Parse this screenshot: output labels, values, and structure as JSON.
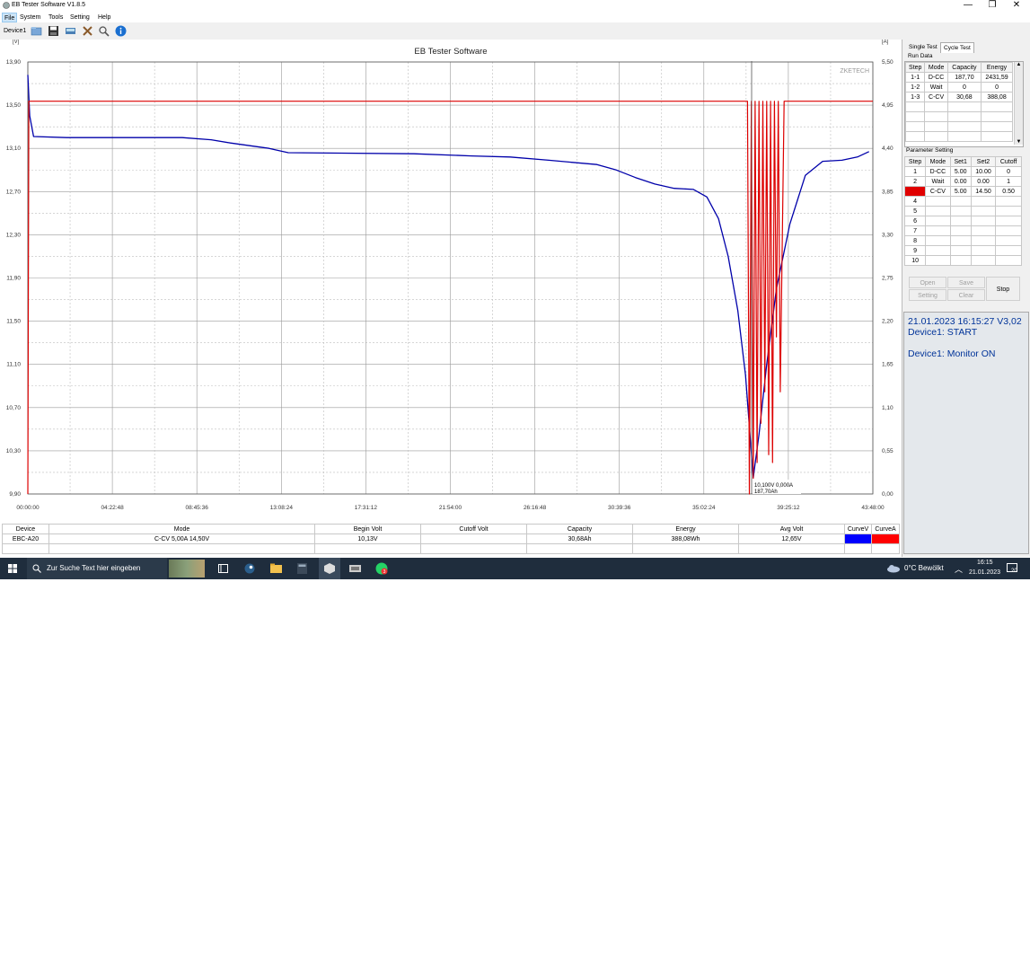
{
  "window": {
    "title": "EB Tester Software V1.8.5",
    "controls": [
      "—",
      "❐",
      "✕"
    ]
  },
  "menu": [
    "File",
    "System",
    "Tools",
    "Setting",
    "Help"
  ],
  "toolbar": {
    "device_label": "Device1",
    "icons": [
      "open-folder-icon",
      "save-icon",
      "monitor-icon",
      "tools-icon",
      "zoom-icon",
      "info-icon"
    ]
  },
  "chart": {
    "title": "EB Tester Software",
    "watermark": "ZKETECH",
    "left_axis_ticks": [
      "13,90",
      "13,50",
      "13,10",
      "12,70",
      "12,30",
      "11,90",
      "11,50",
      "11,10",
      "10,70",
      "10,30",
      "9,90"
    ],
    "right_axis_ticks": [
      "5,50",
      "4,95",
      "4,40",
      "3,85",
      "3,30",
      "2,75",
      "2,20",
      "1,65",
      "1,10",
      "0,55",
      "0,00"
    ],
    "x_axis_ticks": [
      "00:00:00",
      "04:22:48",
      "08:45:36",
      "13:08:24",
      "17:31:12",
      "21:54:00",
      "26:16:48",
      "30:39:36",
      "35:02:24",
      "39:25:12",
      "43:48:00"
    ],
    "left_unit": "[V]",
    "right_unit": "[A]",
    "cursor_label_line1": "10,100V  0,000A",
    "cursor_label_line2": "187,70Ah"
  },
  "chart_data": {
    "type": "line",
    "title": "EB Tester Software",
    "xlabel": "",
    "ylabel": "[V]",
    "y2label": "[A]",
    "ylim": [
      9.9,
      13.9
    ],
    "y2lim": [
      0,
      5.5
    ],
    "x_unit": "hours",
    "xlim": [
      0,
      43.8
    ],
    "grid": true,
    "series": [
      {
        "axis": "left",
        "color": "#0000aa",
        "x": [
          0,
          0.1,
          0.3,
          2,
          8,
          9.5,
          10.5,
          12.5,
          13.5,
          20,
          23,
          25,
          27,
          29.5,
          30.5,
          31.5,
          32.5,
          33.5,
          34.5,
          35.2,
          35.8,
          36.3,
          36.8,
          37.2,
          37.45,
          37.6,
          37.9,
          38.3,
          38.8,
          39.5,
          40.3,
          41.2,
          42.2,
          43.0,
          43.6
        ],
        "y": [
          13.78,
          13.4,
          13.21,
          13.2,
          13.2,
          13.18,
          13.15,
          13.1,
          13.06,
          13.05,
          13.03,
          13.02,
          12.99,
          12.95,
          12.9,
          12.83,
          12.77,
          12.73,
          12.72,
          12.65,
          12.45,
          12.1,
          11.6,
          11.0,
          10.4,
          10.05,
          10.45,
          11.1,
          11.8,
          12.4,
          12.85,
          12.98,
          12.99,
          13.02,
          13.07
        ]
      },
      {
        "axis": "right",
        "color": "#dd0000",
        "x": [
          0,
          0.05,
          0.1,
          37.3,
          37.4,
          37.5,
          37.6,
          37.7,
          37.8,
          37.9,
          38.0,
          38.1,
          38.2,
          38.3,
          38.4,
          38.5,
          38.6,
          38.7,
          38.8,
          38.9,
          39.0,
          39.2,
          43.8
        ],
        "y": [
          0,
          5.0,
          5.0,
          5.0,
          0,
          5.0,
          0.2,
          5.0,
          0.4,
          5.0,
          0.9,
          5.0,
          1.3,
          5.0,
          0.5,
          5.0,
          0.4,
          5.0,
          2.0,
          5.0,
          1.3,
          5.0,
          5.0
        ]
      }
    ]
  },
  "right_panel": {
    "tabs": [
      "Single Test",
      "Cycle Test"
    ],
    "run_data": {
      "label": "Run Data",
      "headers": [
        "Step",
        "Mode",
        "Capacity",
        "Energy"
      ],
      "rows": [
        [
          "1-1",
          "D-CC",
          "187,70",
          "2431,59"
        ],
        [
          "1-2",
          "Wait",
          "0",
          "0"
        ],
        [
          "1-3",
          "C-CV",
          "30,68",
          "388,08"
        ]
      ]
    },
    "param_setting": {
      "label": "Parameter Setting",
      "headers": [
        "Step",
        "Mode",
        "Set1",
        "Set2",
        "Cutoff"
      ],
      "rows": [
        [
          "1",
          "D-CC",
          "5.00",
          "10.00",
          "0"
        ],
        [
          "2",
          "Wait",
          "0.00",
          "0.00",
          "1"
        ],
        [
          "3",
          "C-CV",
          "5.00",
          "14.50",
          "0.50"
        ],
        [
          "4",
          "",
          "",
          "",
          ""
        ],
        [
          "5",
          "",
          "",
          "",
          ""
        ],
        [
          "6",
          "",
          "",
          "",
          ""
        ],
        [
          "7",
          "",
          "",
          "",
          ""
        ],
        [
          "8",
          "",
          "",
          "",
          ""
        ],
        [
          "9",
          "",
          "",
          "",
          ""
        ],
        [
          "10",
          "",
          "",
          "",
          ""
        ]
      ]
    },
    "buttons": {
      "open": "Open",
      "save": "Save",
      "setting": "Setting",
      "clear": "Clear",
      "stop": "Stop"
    },
    "log": [
      "21.01.2023 16:15:27  V3,02",
      "Device1: START",
      "",
      "Device1: Monitor ON"
    ]
  },
  "bottom_table": {
    "headers": [
      "Device",
      "Mode",
      "Begin Volt",
      "Cutoff Volt",
      "Capacity",
      "Energy",
      "Avg Volt",
      "CurveV",
      "CurveA"
    ],
    "row": [
      "EBC-A20",
      "C-CV  5,00A  14,50V",
      "10,13V",
      "",
      "30,68Ah",
      "388,08Wh",
      "12,65V"
    ],
    "curve_colors": {
      "v": "#0000ff",
      "a": "#ff0000"
    }
  },
  "taskbar": {
    "search_placeholder": "Zur Suche Text hier eingeben",
    "weather": "0°C  Bewölkt",
    "time": "16:15",
    "date": "21.01.2023",
    "notification_count": "20"
  }
}
